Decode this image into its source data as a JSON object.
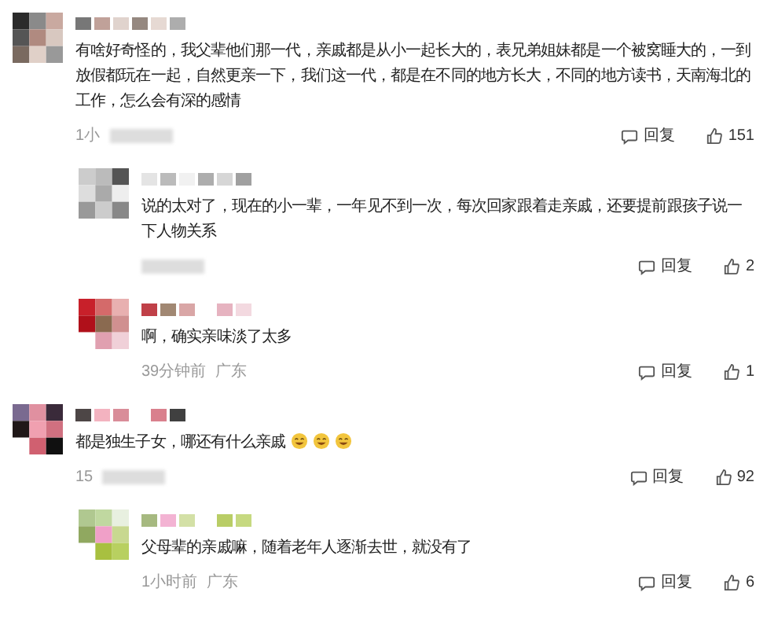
{
  "comments": [
    {
      "text": "有啥好奇怪的，我父辈他们那一代，亲戚都是从小一起长大的，表兄弟姐妹都是一个被窝睡大的，一到放假都玩在一起，自然更亲一下，我们这一代，都是在不同的地方长大，不同的地方读书，天南海北的工作，怎么会有深的感情",
      "time": "1小",
      "reply_label": "回复",
      "likes": "151",
      "children": [
        {
          "text": "说的太对了，现在的小一辈，一年见不到一次，每次回家跟着走亲戚，还要提前跟孩子说一下人物关系",
          "reply_label": "回复",
          "likes": "2"
        },
        {
          "text": "啊，确实亲味淡了太多",
          "time": "39分钟前",
          "region": "广东",
          "reply_label": "回复",
          "likes": "1"
        }
      ]
    },
    {
      "text": "都是独生子女，哪还有什么亲戚",
      "emojis": [
        {
          "kind": "grin"
        },
        {
          "kind": "grin"
        },
        {
          "kind": "grin"
        }
      ],
      "time": "15",
      "reply_label": "回复",
      "likes": "92",
      "children": [
        {
          "text": "父母辈的亲戚嘛，随着老年人逐渐去世，就没有了",
          "time": "1小时前",
          "region": "广东",
          "reply_label": "回复",
          "likes": "6"
        }
      ]
    }
  ]
}
